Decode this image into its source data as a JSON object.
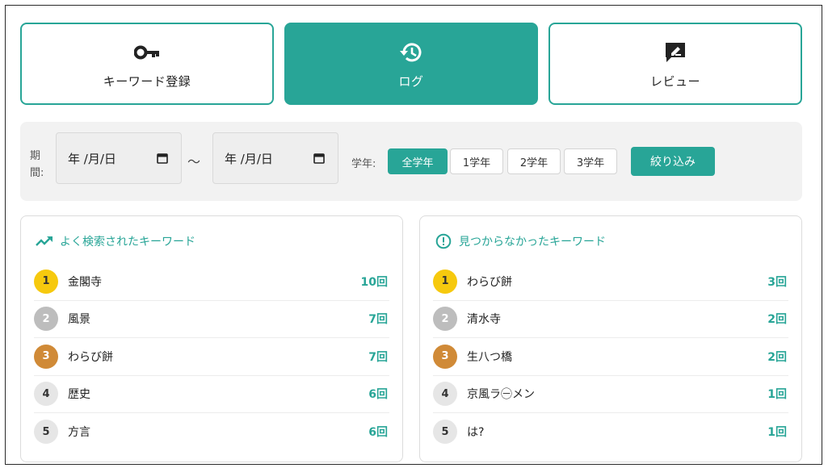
{
  "tabs": [
    {
      "label": "キーワード登録",
      "icon": "key-icon",
      "active": false
    },
    {
      "label": "ログ",
      "icon": "history-icon",
      "active": true
    },
    {
      "label": "レビュー",
      "icon": "review-icon",
      "active": false
    }
  ],
  "filter": {
    "period_label": "期間:",
    "date_from_placeholder": "年 /月/日",
    "date_to_placeholder": "年 /月/日",
    "range_separator": "～",
    "grade_label": "学年:",
    "grades": [
      "全学年",
      "1学年",
      "2学年",
      "3学年"
    ],
    "selected_grade": "全学年",
    "submit_label": "絞り込み"
  },
  "popular": {
    "title": "よく検索されたキーワード",
    "items": [
      {
        "rank": "1",
        "keyword": "金閣寺",
        "count": "10回"
      },
      {
        "rank": "2",
        "keyword": "風景",
        "count": "7回"
      },
      {
        "rank": "3",
        "keyword": "わらび餅",
        "count": "7回"
      },
      {
        "rank": "4",
        "keyword": "歴史",
        "count": "6回"
      },
      {
        "rank": "5",
        "keyword": "方言",
        "count": "6回"
      }
    ]
  },
  "notfound": {
    "title": "見つからなかったキーワード",
    "items": [
      {
        "rank": "1",
        "keyword": "わらび餅",
        "count": "3回"
      },
      {
        "rank": "2",
        "keyword": "清水寺",
        "count": "2回"
      },
      {
        "rank": "3",
        "keyword": "生八つ橋",
        "count": "2回"
      },
      {
        "rank": "4",
        "keyword": "京風ラ㊀メン",
        "count": "1回"
      },
      {
        "rank": "5",
        "keyword": "は?",
        "count": "1回"
      }
    ]
  },
  "colors": {
    "accent": "#28a597",
    "gold": "#f6c90e",
    "silver": "#bdbdbd",
    "bronze": "#d08a37"
  }
}
